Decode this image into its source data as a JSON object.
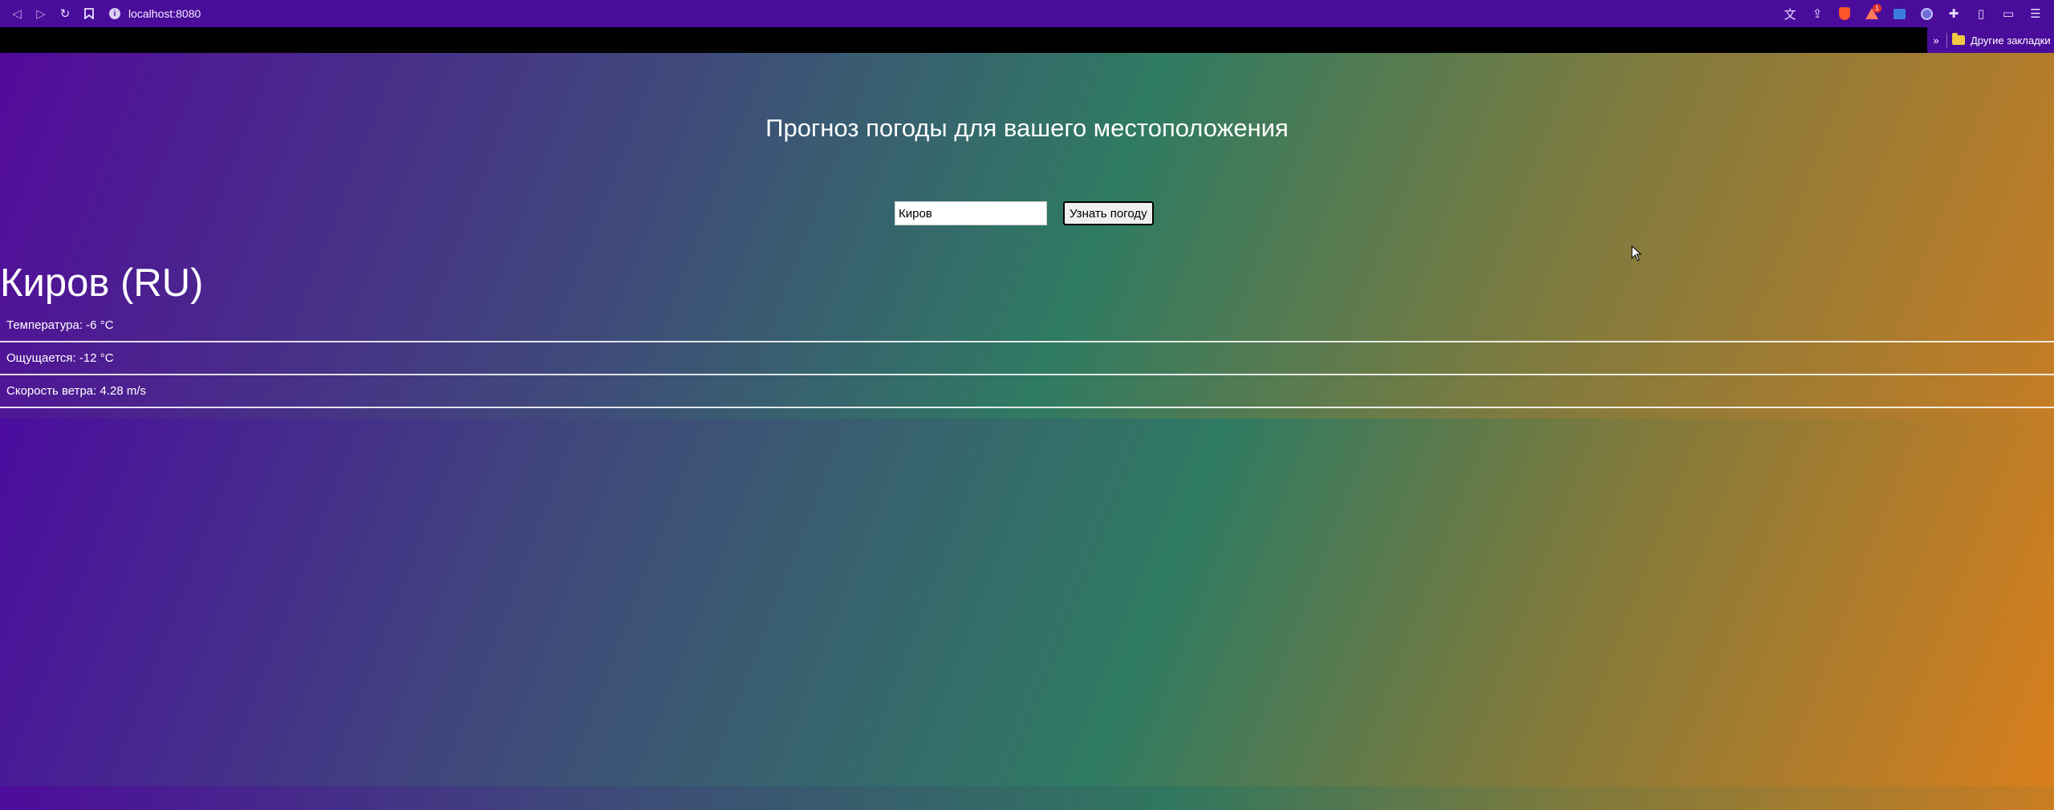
{
  "browser": {
    "url": "localhost:8080",
    "bookmarks_folder_label": "Другие закладки",
    "rewards_badge": "1"
  },
  "page": {
    "title": "Прогноз погоды для вашего местоположения",
    "search": {
      "value": "Киров",
      "button_label": "Узнать погоду"
    },
    "result": {
      "city": "Киров (RU)",
      "rows": [
        "Температура: -6 °C",
        "Ощущается: -12 °C",
        "Скорость ветра: 4.28 m/s"
      ]
    }
  },
  "colors": {
    "chrome": "#4a0c9a",
    "gradient_start": "#530a9c",
    "gradient_mid": "#2f7b62",
    "gradient_end": "#d77c1e"
  }
}
